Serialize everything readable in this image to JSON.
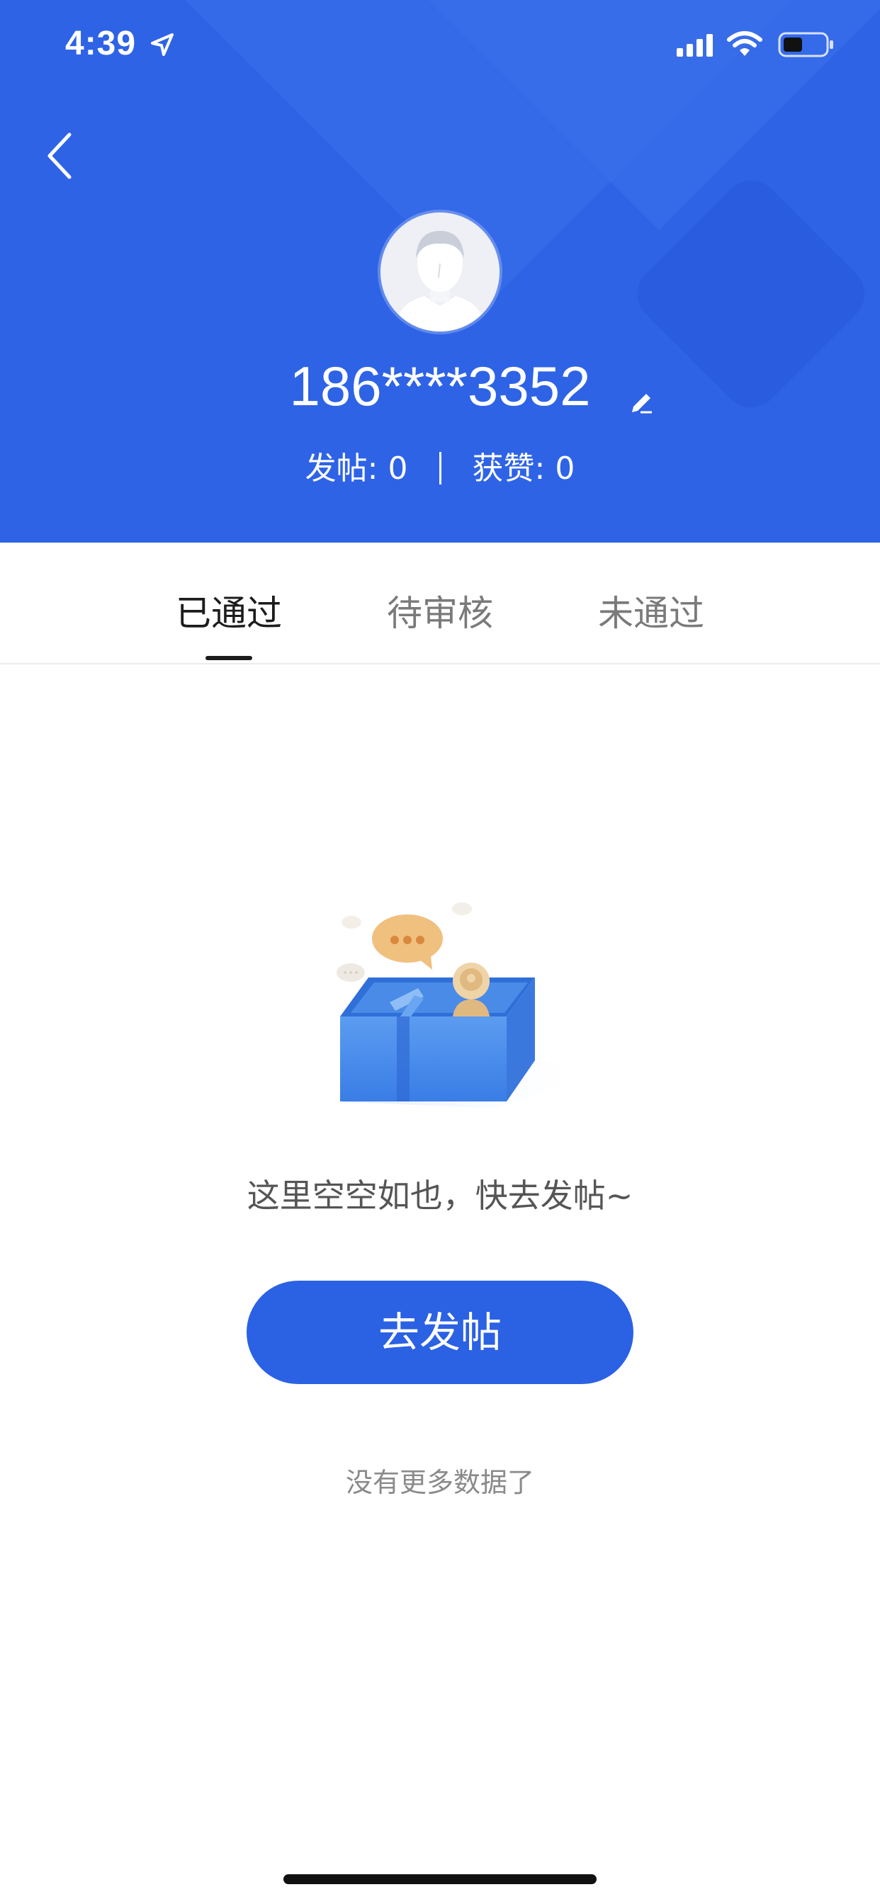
{
  "status_bar": {
    "time": "4:39"
  },
  "profile": {
    "username": "186****3352",
    "posts_label": "发帖:",
    "posts_count": "0",
    "likes_label": "获赞:",
    "likes_count": "0"
  },
  "tabs": [
    {
      "label": "已通过",
      "active": true
    },
    {
      "label": "待审核",
      "active": false
    },
    {
      "label": "未通过",
      "active": false
    }
  ],
  "empty_state": {
    "message": "这里空空如也，快去发帖~",
    "button_label": "去发帖",
    "footer": "没有更多数据了"
  },
  "colors": {
    "header_blue": "#2e63e6",
    "button_blue": "#2b61e3",
    "text_dark": "#1c1c1c",
    "text_gray": "#7a7a7a"
  },
  "icons": [
    "location-arrow-icon",
    "cellular-signal-icon",
    "wifi-icon",
    "battery-icon",
    "back-chevron-icon",
    "edit-pencil-icon",
    "default-avatar",
    "empty-box-illustration"
  ]
}
